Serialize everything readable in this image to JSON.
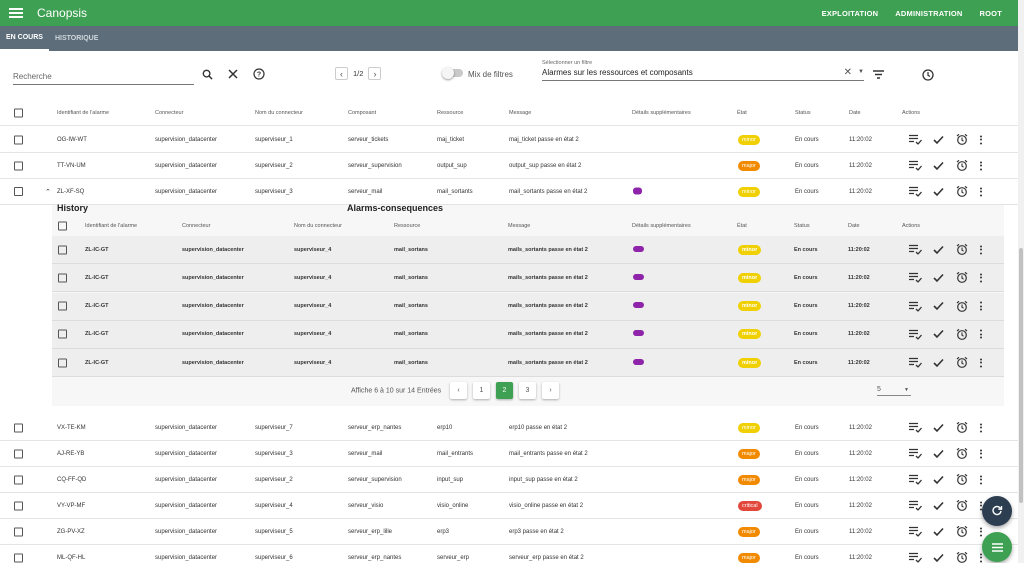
{
  "app": {
    "title": "Canopsis",
    "nav": [
      "EXPLOITATION",
      "ADMINISTRATION",
      "ROOT"
    ]
  },
  "tabs": [
    "EN COURS",
    "HISTORIQUE"
  ],
  "toolbar": {
    "search_placeholder": "Recherche",
    "page": "1/2",
    "mix_label": "Mix de filtres",
    "filter_caption": "Sélectionner un filtre",
    "filter_value": "Alarmes sur les ressources et composants"
  },
  "columns": [
    "Identifiant de l'alarme",
    "Connecteur",
    "Nom du connecteur",
    "Composant",
    "Ressource",
    "Message",
    "Détails supplémentaires",
    "État",
    "Status",
    "Date",
    "Actions"
  ],
  "rows_top": [
    {
      "id": "OG-IW-WT",
      "connector": "supervision_datacenter",
      "name": "superviseur_1",
      "component": "serveur_tickets",
      "resource": "maj_ticket",
      "message": "maj_ticket passe en état 2",
      "state": "minor",
      "status": "En cours",
      "date": "11:20:02"
    },
    {
      "id": "TT-VN-UM",
      "connector": "supervision_datacenter",
      "name": "superviseur_2",
      "component": "serveur_supervision",
      "resource": "output_sup",
      "message": "output_sup passe en état 2",
      "state": "major",
      "status": "En cours",
      "date": "11:20:02"
    },
    {
      "id": "ZL-XF-SQ",
      "connector": "supervision_datacenter",
      "name": "superviseur_3",
      "component": "serveur_mail",
      "resource": "mail_sortants",
      "message": "mail_sortants passe en état 2",
      "state": "minor",
      "status": "En cours",
      "date": "11:20:02"
    }
  ],
  "expanded": {
    "history_title": "History",
    "consequences_title": "Alarms-consequences",
    "columns": [
      "Identifiant de l'alarme",
      "Connecteur",
      "Nom du connecteur",
      "Ressource",
      "Message",
      "Détails supplémentaires",
      "État",
      "Status",
      "Date",
      "Actions"
    ],
    "rows": [
      {
        "id": "ZL-IC-GT",
        "connector": "supervision_datacenter",
        "name": "superviseur_4",
        "resource": "mail_sortans",
        "message": "mails_sortants passe en état 2",
        "state": "minor",
        "status": "En cours",
        "date": "11:20:02"
      },
      {
        "id": "ZL-IC-GT",
        "connector": "supervision_datacenter",
        "name": "superviseur_4",
        "resource": "mail_sortans",
        "message": "mails_sortants passe en état 2",
        "state": "minor",
        "status": "En cours",
        "date": "11:20:02"
      },
      {
        "id": "ZL-IC-GT",
        "connector": "supervision_datacenter",
        "name": "superviseur_4",
        "resource": "mail_sortans",
        "message": "mails_sortants passe en état 2",
        "state": "minor",
        "status": "En cours",
        "date": "11:20:02"
      },
      {
        "id": "ZL-IC-GT",
        "connector": "supervision_datacenter",
        "name": "superviseur_4",
        "resource": "mail_sortans",
        "message": "mails_sortants passe en état 2",
        "state": "minor",
        "status": "En cours",
        "date": "11:20:02"
      },
      {
        "id": "ZL-IC-GT",
        "connector": "supervision_datacenter",
        "name": "superviseur_4",
        "resource": "mail_sortans",
        "message": "mails_sortants passe en état 2",
        "state": "minor",
        "status": "En cours",
        "date": "11:20:02"
      }
    ],
    "pager": {
      "summary": "Affiche 6 à 10 sur 14 Entrées",
      "pages": [
        "1",
        "2",
        "3"
      ],
      "per_page": "5"
    }
  },
  "rows_bottom": [
    {
      "id": "VX-TE-KM",
      "connector": "supervision_datacenter",
      "name": "superviseur_7",
      "component": "serveur_erp_nantes",
      "resource": "erp10",
      "message": "erp10 passe en état 2",
      "state": "minor",
      "status": "En cours",
      "date": "11:20:02"
    },
    {
      "id": "AJ-RE-YB",
      "connector": "supervision_datacenter",
      "name": "superviseur_3",
      "component": "serveur_mail",
      "resource": "mail_entrants",
      "message": "mail_entrants passe en état 2",
      "state": "major",
      "status": "En cours",
      "date": "11:20:02"
    },
    {
      "id": "CQ-FF-QD",
      "connector": "supervision_datacenter",
      "name": "superviseur_2",
      "component": "serveur_supervision",
      "resource": "input_sup",
      "message": "input_sup passe en état 2",
      "state": "major",
      "status": "En cours",
      "date": "11:20:02"
    },
    {
      "id": "VY-VP-MF",
      "connector": "supervision_datacenter",
      "name": "superviseur_4",
      "component": "serveur_visio",
      "resource": "visio_online",
      "message": "visio_online passe en état 2",
      "state": "critical",
      "status": "En cours",
      "date": "11:20:02"
    },
    {
      "id": "ZG-PV-XZ",
      "connector": "supervision_datacenter",
      "name": "superviseur_5",
      "component": "serveur_erp_lille",
      "resource": "erp3",
      "message": "erp3 passe en état 2",
      "state": "major",
      "status": "En cours",
      "date": "11:20:02"
    },
    {
      "id": "ML-QF-HL",
      "connector": "supervision_datacenter",
      "name": "superviseur_6",
      "component": "serveur_erp_nantes",
      "resource": "serveur_erp",
      "message": "serveur_erp passe en état 2",
      "state": "major",
      "status": "En cours",
      "date": "11:20:02"
    }
  ],
  "colors": {
    "accent": "#3ea052",
    "tabbar": "#5d6e7a",
    "minor": "#f0d000",
    "major": "#f28a00",
    "critical": "#e2473c",
    "fab_refresh": "#2c3e50"
  },
  "icons": {
    "menu": "menu-icon",
    "search": "search-icon",
    "clear": "close-icon",
    "help": "help-icon",
    "filter": "filter-list-icon",
    "history": "clock-icon",
    "actions": [
      "playlist-check-icon",
      "check-icon",
      "alarm-clock-icon",
      "more-vert-icon"
    ],
    "fab": [
      "refresh-icon",
      "menu-icon"
    ]
  }
}
